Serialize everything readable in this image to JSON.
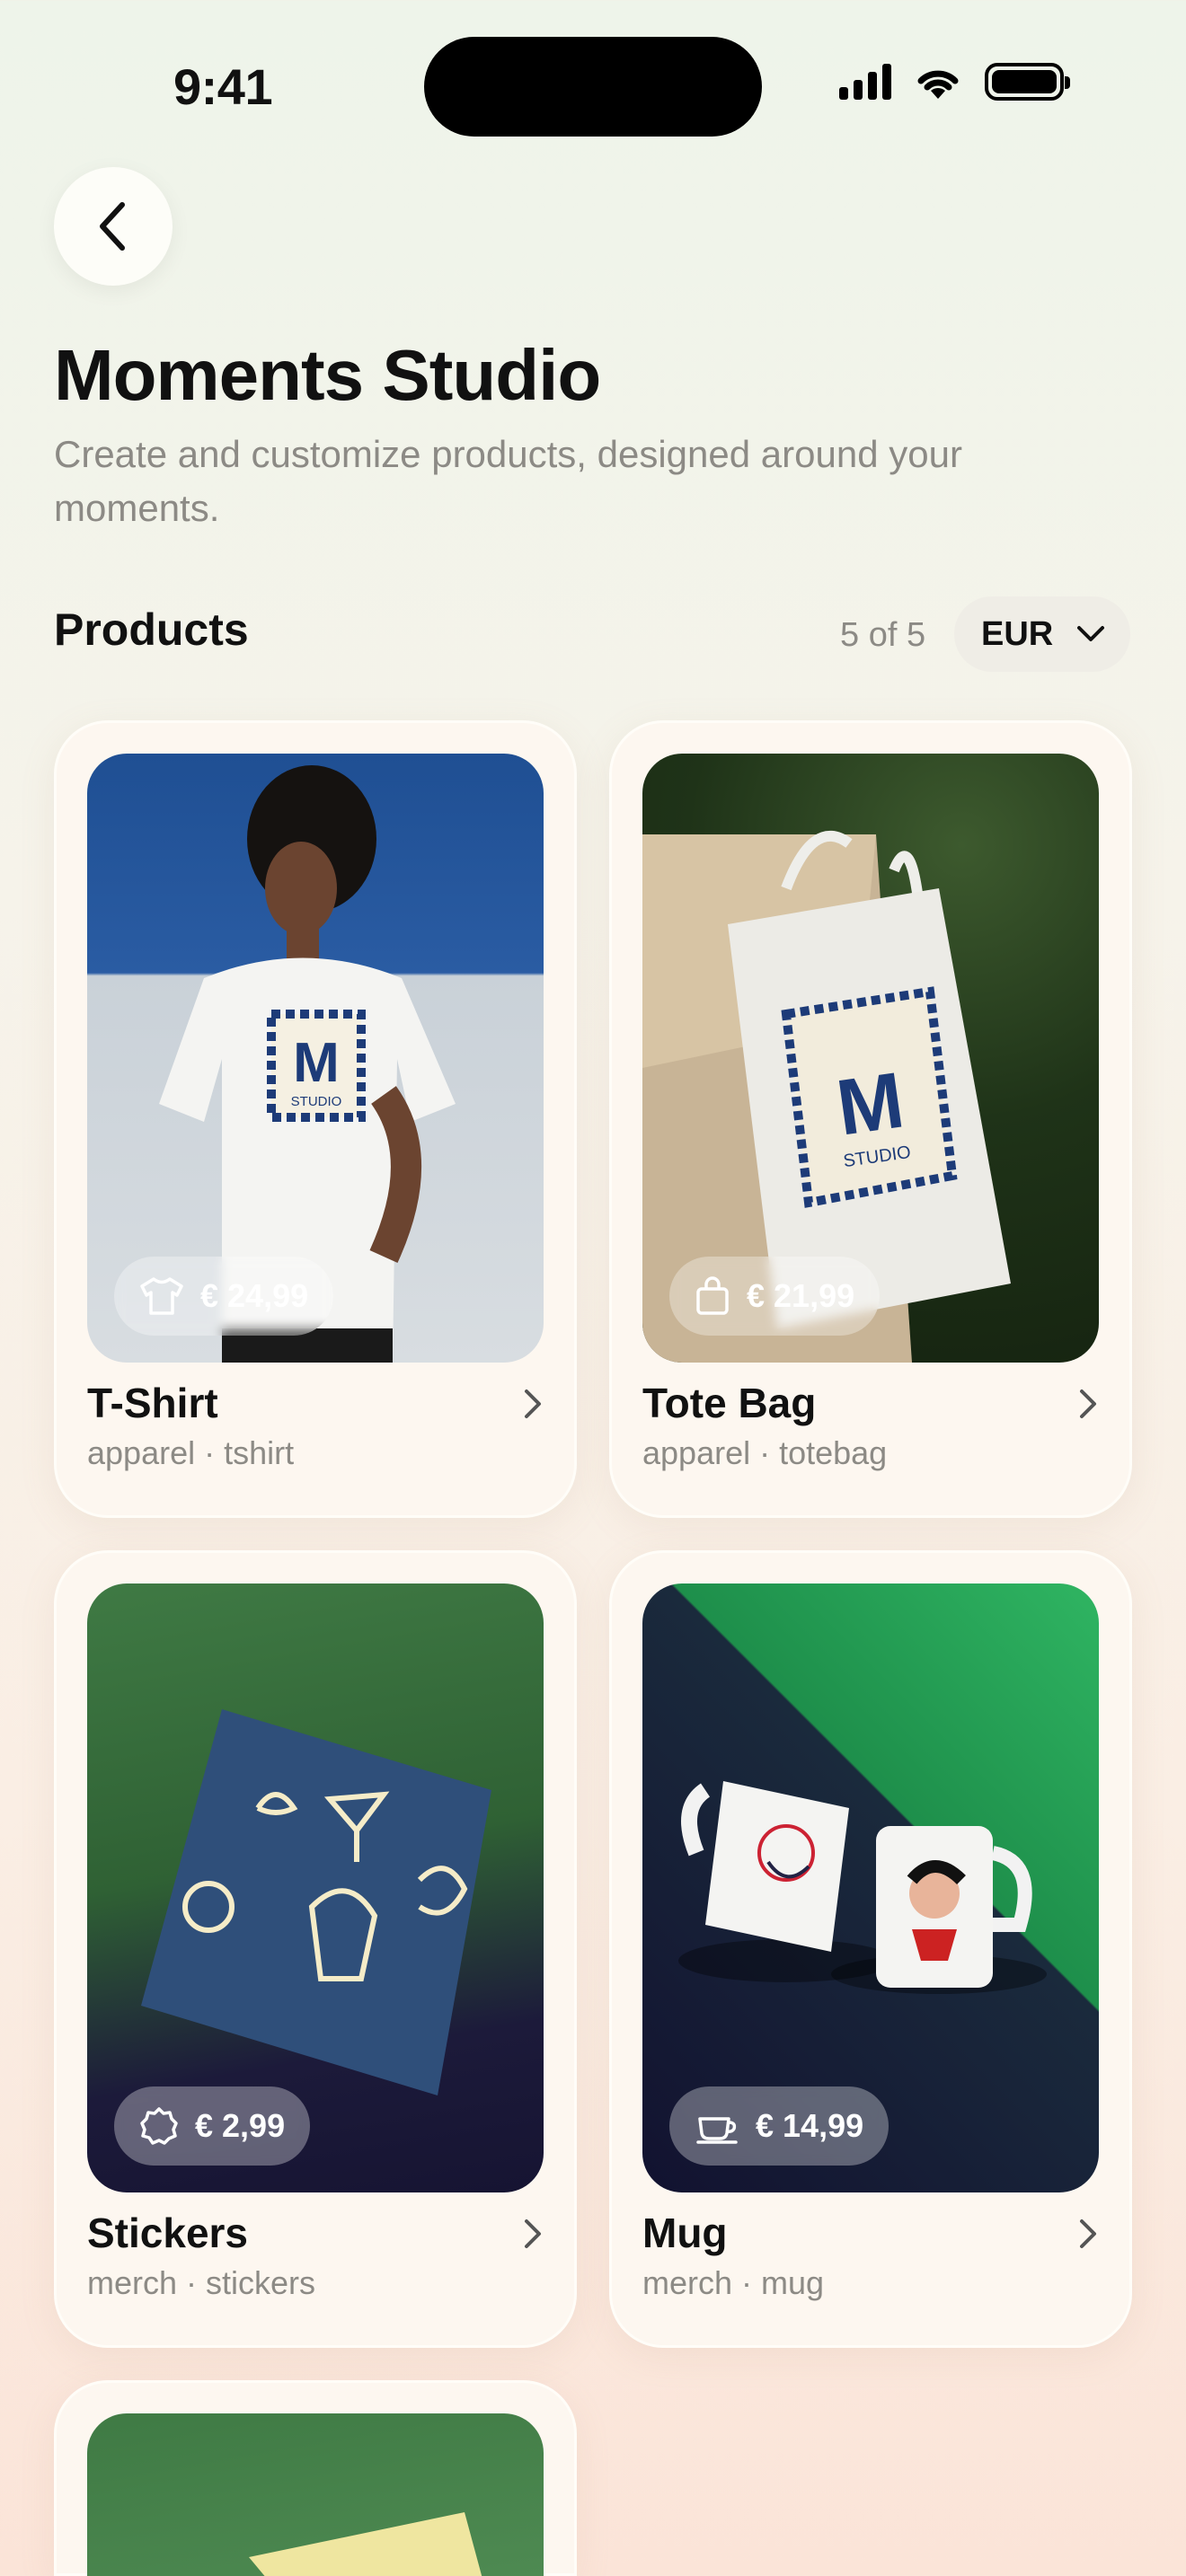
{
  "status_bar": {
    "time": "9:41"
  },
  "header": {
    "title": "Moments Studio",
    "subtitle": "Create and customize products, designed around your moments."
  },
  "products_section": {
    "label": "Products",
    "count": "5 of 5",
    "currency": "EUR"
  },
  "products": [
    {
      "name": "T-Shirt",
      "tags": "apparel · tshirt",
      "price": "€ 24,99",
      "icon": "tshirt-icon"
    },
    {
      "name": "Tote Bag",
      "tags": "apparel · totebag",
      "price": "€ 21,99",
      "icon": "bag-icon"
    },
    {
      "name": "Stickers",
      "tags": "merch · stickers",
      "price": "€ 2,99",
      "icon": "sticker-icon"
    },
    {
      "name": "Mug",
      "tags": "merch · mug",
      "price": "€ 14,99",
      "icon": "mug-icon"
    }
  ]
}
